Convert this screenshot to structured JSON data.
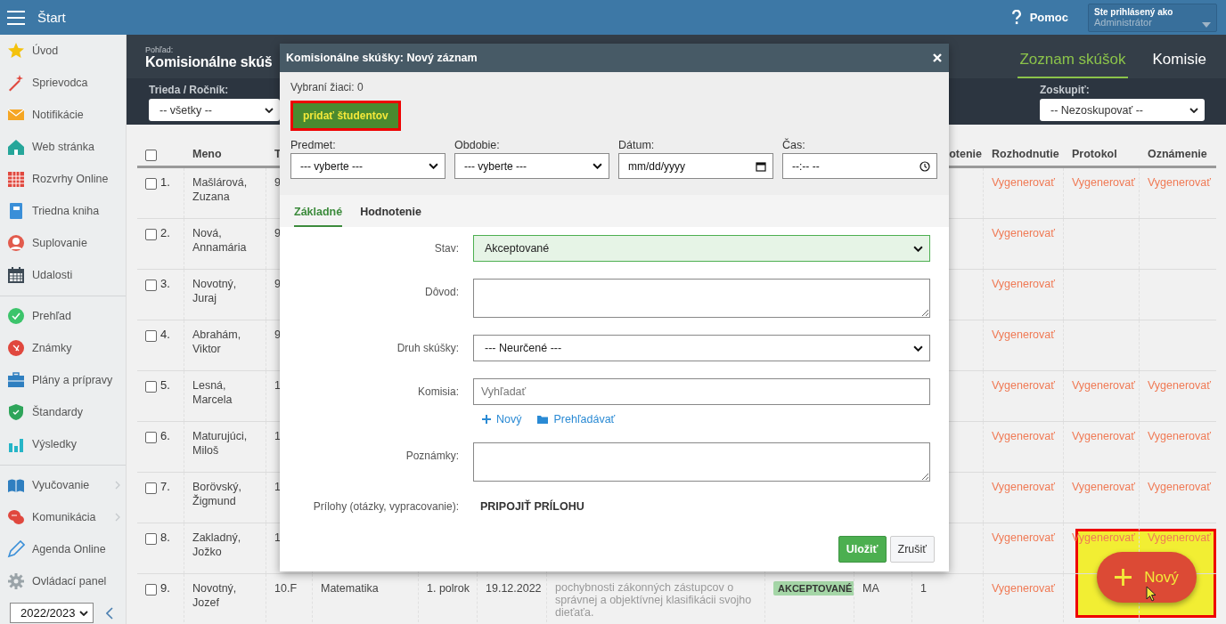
{
  "top_bar": {
    "title": "Štart",
    "help": "Pomoc",
    "user_caption": "Ste prihlásený ako",
    "user_name": "Administrátor"
  },
  "sidebar": {
    "groups": [
      {
        "items": [
          {
            "label": "Úvod",
            "submenu": false
          },
          {
            "label": "Sprievodca",
            "submenu": false
          },
          {
            "label": "Notifikácie",
            "submenu": false
          },
          {
            "label": "Web stránka",
            "submenu": false
          },
          {
            "label": "Rozvrhy Online",
            "submenu": false
          },
          {
            "label": "Triedna kniha",
            "submenu": false
          },
          {
            "label": "Suplovanie",
            "submenu": false
          },
          {
            "label": "Udalosti",
            "submenu": false
          }
        ]
      },
      {
        "items": [
          {
            "label": "Prehľad",
            "submenu": false
          },
          {
            "label": "Známky",
            "submenu": false
          },
          {
            "label": "Plány a prípravy",
            "submenu": false
          },
          {
            "label": "Štandardy",
            "submenu": false
          },
          {
            "label": "Výsledky",
            "submenu": false
          }
        ]
      },
      {
        "items": [
          {
            "label": "Vyučovanie",
            "submenu": true
          },
          {
            "label": "Komunikácia",
            "submenu": true
          },
          {
            "label": "Agenda Online",
            "submenu": false
          },
          {
            "label": "Ovládací panel",
            "submenu": false
          }
        ]
      }
    ],
    "year": "2022/2023"
  },
  "page": {
    "view_label": "Pohľad:",
    "title": "Komisionálne skúš",
    "tabs": [
      {
        "label": "Zoznam skúšok",
        "selected": true
      },
      {
        "label": "Komisie",
        "selected": false
      }
    ],
    "filters": [
      {
        "label": "Trieda / Ročník:",
        "value": "-- všetky --"
      },
      {
        "label": "Zoskupiť:",
        "value": "-- Nezoskupovať --"
      }
    ]
  },
  "table": {
    "all_checked": false,
    "columns": {
      "name": "Meno",
      "class": "T",
      "grade": "otenie",
      "decision": "Rozhodnutie",
      "protocol": "Protokol",
      "notice": "Oznámenie"
    },
    "rows": [
      {
        "number": "1.",
        "checked": false,
        "name": "Mašlárová, Zuzana",
        "class": "9",
        "decision": "Vygenerovať",
        "protocol": "Vygenerovať",
        "notice": "Vygenerovať"
      },
      {
        "number": "2.",
        "checked": false,
        "name": "Nová, Annamária",
        "class": "9",
        "decision": "Vygenerovať"
      },
      {
        "number": "3.",
        "checked": false,
        "name": "Novotný, Juraj",
        "class": "9",
        "decision": "Vygenerovať"
      },
      {
        "number": "4.",
        "checked": false,
        "name": "Abrahám, Viktor",
        "class": "9",
        "decision": "Vygenerovať"
      },
      {
        "number": "5.",
        "checked": false,
        "name": "Lesná, Marcela",
        "class": "1",
        "decision": "Vygenerovať",
        "protocol": "Vygenerovať",
        "notice": "Vygenerovať"
      },
      {
        "number": "6.",
        "checked": false,
        "name": "Maturujúci, Miloš",
        "class": "1",
        "decision": "Vygenerovať",
        "protocol": "Vygenerovať",
        "notice": "Vygenerovať"
      },
      {
        "number": "7.",
        "checked": false,
        "name": "Borövský, Žigmund",
        "class": "1",
        "decision": "Vygenerovať",
        "protocol": "Vygenerovať",
        "notice": "Vygenerovať"
      },
      {
        "number": "8.",
        "checked": false,
        "name": "Zakladný, Jožko",
        "class": "1",
        "decision": "Vygenerovať",
        "protocol": "Vygenerovať",
        "notice": "Vygenerovať"
      },
      {
        "number": "9.",
        "checked": false,
        "name": "Novotný, Jozef",
        "class": "10.F",
        "subject": "Matematika",
        "period": "1. polrok",
        "date": "19.12.2022",
        "reason": "pochybnosti zákonných zástupcov o správnej a objektívnej klasifikácii svojho dieťaťa.",
        "status": "AKCEPTOVANÉ",
        "teacher": "MA",
        "grade": "1",
        "decision": "Vygenerovať"
      }
    ]
  },
  "dialog": {
    "title": "Komisionálne skúšky: Nový záznam",
    "selected_count": "Vybraní žiaci: 0",
    "add_button": "pridať študentov",
    "fields": [
      {
        "label": "Predmet:",
        "value": "--- vyberte ---",
        "kind": "select"
      },
      {
        "label": "Obdobie:",
        "value": "--- vyberte ---",
        "kind": "select"
      },
      {
        "label": "Dátum:",
        "value": "mm/dd/yyyy",
        "kind": "date"
      },
      {
        "label": "Čas:",
        "value": "--:-- --",
        "kind": "time"
      }
    ],
    "tabs": [
      {
        "label": "Základné",
        "selected": true
      },
      {
        "label": "Hodnotenie",
        "selected": false
      }
    ],
    "form": [
      {
        "label": "Stav:",
        "kind": "select",
        "value": "Akceptované",
        "valid": true
      },
      {
        "label": "Dôvod:",
        "kind": "textarea"
      },
      {
        "label": "Druh skúšky:",
        "kind": "select",
        "value": "--- Neurčené ---",
        "valid": false
      },
      {
        "label": "Komisia:",
        "kind": "search",
        "placeholder": "Vyhľadať",
        "links": [
          "Nový",
          "Prehľadávať"
        ]
      },
      {
        "label": "Poznámky:",
        "kind": "textarea"
      },
      {
        "label": "Prílohy (otázky, vypracovanie):",
        "kind": "attachment",
        "value": "PRIPOJIŤ PRÍLOHU"
      }
    ],
    "save": "Uložiť",
    "cancel": "Zrušiť"
  },
  "fab": {
    "label": "Nový"
  }
}
